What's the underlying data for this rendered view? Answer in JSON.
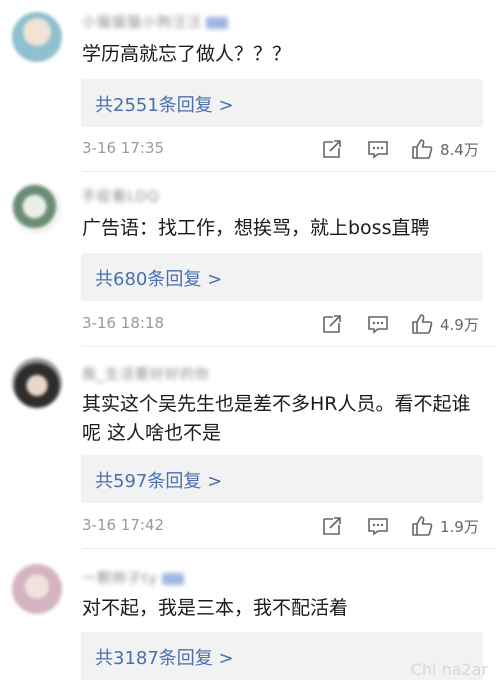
{
  "comments": [
    {
      "username": "小猫猫猫小狗汪汪",
      "text": "学历高就忘了做人？？？",
      "replies_label": "共2551条回复 >",
      "time": "3-16 17:35",
      "likes": "8.4万",
      "avatar_color": "#9cc5cf"
    },
    {
      "username": "手捉着LDQ",
      "text": "广告语：找工作，想挨骂，就上boss直聘",
      "replies_label": "共680条回复 >",
      "time": "3-16 18:18",
      "likes": "4.9万",
      "avatar_color": "#5d7b66"
    },
    {
      "username": "我_生活要好好的你",
      "text": "其实这个吴先生也是差不多HR人员。看不起谁呢 这人啥也不是",
      "replies_label": "共597条回复 >",
      "time": "3-16 17:42",
      "likes": "1.9万",
      "avatar_color": "#3a3a3a"
    },
    {
      "username": "一颗柿子ty",
      "text": "对不起，我是三本，我不配活着",
      "replies_label": "共3187条回复 >",
      "avatar_color": "#d7b9c4"
    }
  ],
  "icons": {
    "share": "share-icon",
    "reply": "comment-icon",
    "like": "thumbs-up-icon"
  },
  "watermark": "Chi na2ar"
}
